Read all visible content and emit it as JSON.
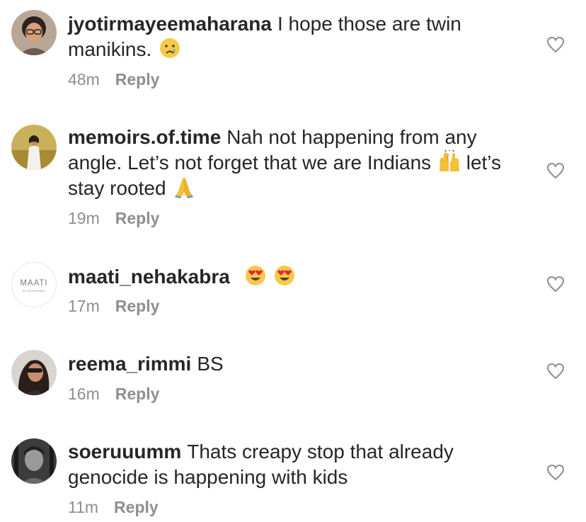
{
  "comments": [
    {
      "username": "jyotirmayeemaharana",
      "text": "I hope those are twin manikins.",
      "emojis": [
        "crying-face"
      ],
      "time": "48m",
      "reply_label": "Reply",
      "avatar": "profile-photo"
    },
    {
      "username": "memoirs.of.time",
      "text": "Nah not happening from any angle. Let’s not forget that we are Indians",
      "text_after_emoji": "let’s stay rooted",
      "emojis": [
        "raising-hands",
        "folded-hands"
      ],
      "time": "19m",
      "reply_label": "Reply",
      "avatar": "profile-photo"
    },
    {
      "username": "maati_nehakabra",
      "text": "",
      "emojis": [
        "heart-eyes",
        "heart-eyes"
      ],
      "time": "17m",
      "reply_label": "Reply",
      "avatar_logo": {
        "title": "MAATI",
        "subtitle": "BY NEHA KABRA"
      }
    },
    {
      "username": "reema_rimmi",
      "text": "BS",
      "emojis": [],
      "time": "16m",
      "reply_label": "Reply",
      "avatar": "profile-photo"
    },
    {
      "username": "soeruuumm",
      "text": "Thats creapy stop that already genocide is happening with kids",
      "emojis": [],
      "time": "11m",
      "reply_label": "Reply",
      "avatar": "profile-photo"
    }
  ],
  "icons": {
    "like": "heart-outline-icon"
  },
  "colors": {
    "text": "#262626",
    "meta": "#8e8e8e",
    "heart": "#8e8e8e"
  }
}
